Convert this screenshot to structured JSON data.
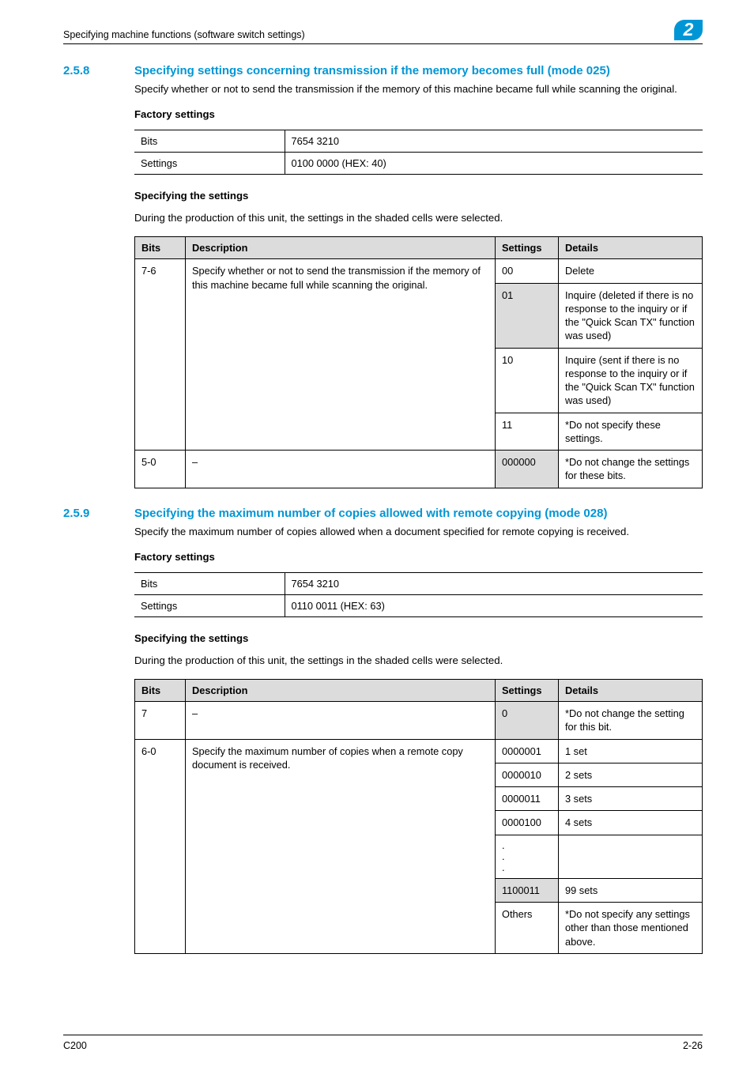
{
  "header": {
    "breadcrumb": "Specifying machine functions (software switch settings)",
    "chapter_number": "2"
  },
  "section_258": {
    "number": "2.5.8",
    "title": "Specifying settings concerning transmission if the memory becomes full (mode 025)",
    "intro": "Specify whether or not to send the transmission if the memory of this machine became full while scanning the original.",
    "factory_heading": "Factory settings",
    "factory_table": {
      "row1_label": "Bits",
      "row1_value": "7654 3210",
      "row2_label": "Settings",
      "row2_value": "0100 0000 (HEX: 40)"
    },
    "spec_heading": "Specifying the settings",
    "spec_note": "During the production of this unit, the settings in the shaded cells were selected.",
    "table": {
      "headers": {
        "bits": "Bits",
        "description": "Description",
        "settings": "Settings",
        "details": "Details"
      },
      "r1_bits": "7-6",
      "r1_desc": "Specify whether or not to send the transmission if the memory of this machine became full while scanning the original.",
      "r1a_set": "00",
      "r1a_det": "Delete",
      "r1b_set": "01",
      "r1b_det": "Inquire (deleted if there is no response to the inquiry or if the \"Quick Scan TX\" function was used)",
      "r1c_set": "10",
      "r1c_det": "Inquire (sent if there is no response to the inquiry or if the \"Quick Scan TX\" function was used)",
      "r1d_set": "11",
      "r1d_det": "*Do not specify these settings.",
      "r2_bits": "5-0",
      "r2_desc": "–",
      "r2_set": "000000",
      "r2_det": "*Do not change the settings for these bits."
    }
  },
  "section_259": {
    "number": "2.5.9",
    "title": "Specifying the maximum number of copies allowed with remote copying (mode 028)",
    "intro": "Specify the maximum number of copies allowed when a document specified for remote copying is received.",
    "factory_heading": "Factory settings",
    "factory_table": {
      "row1_label": "Bits",
      "row1_value": "7654 3210",
      "row2_label": "Settings",
      "row2_value": "0110 0011 (HEX: 63)"
    },
    "spec_heading": "Specifying the settings",
    "spec_note": "During the production of this unit, the settings in the shaded cells were selected.",
    "table": {
      "headers": {
        "bits": "Bits",
        "description": "Description",
        "settings": "Settings",
        "details": "Details"
      },
      "r1_bits": "7",
      "r1_desc": "–",
      "r1_set": "0",
      "r1_det": "*Do not change the setting for this bit.",
      "r2_bits": "6-0",
      "r2_desc": "Specify the maximum number of copies when a remote copy document is received.",
      "r2a_set": "0000001",
      "r2a_det": "1 set",
      "r2b_set": "0000010",
      "r2b_det": "2 sets",
      "r2c_set": "0000011",
      "r2c_det": "3 sets",
      "r2d_set": "0000100",
      "r2d_det": "4 sets",
      "r2e_set": ".\n.\n.",
      "r2e_det": "",
      "r2f_set": "1100011",
      "r2f_det": "99 sets",
      "r2g_set": "Others",
      "r2g_det": "*Do not specify any settings other than those mentioned above."
    }
  },
  "footer": {
    "left": "C200",
    "right": "2-26"
  }
}
